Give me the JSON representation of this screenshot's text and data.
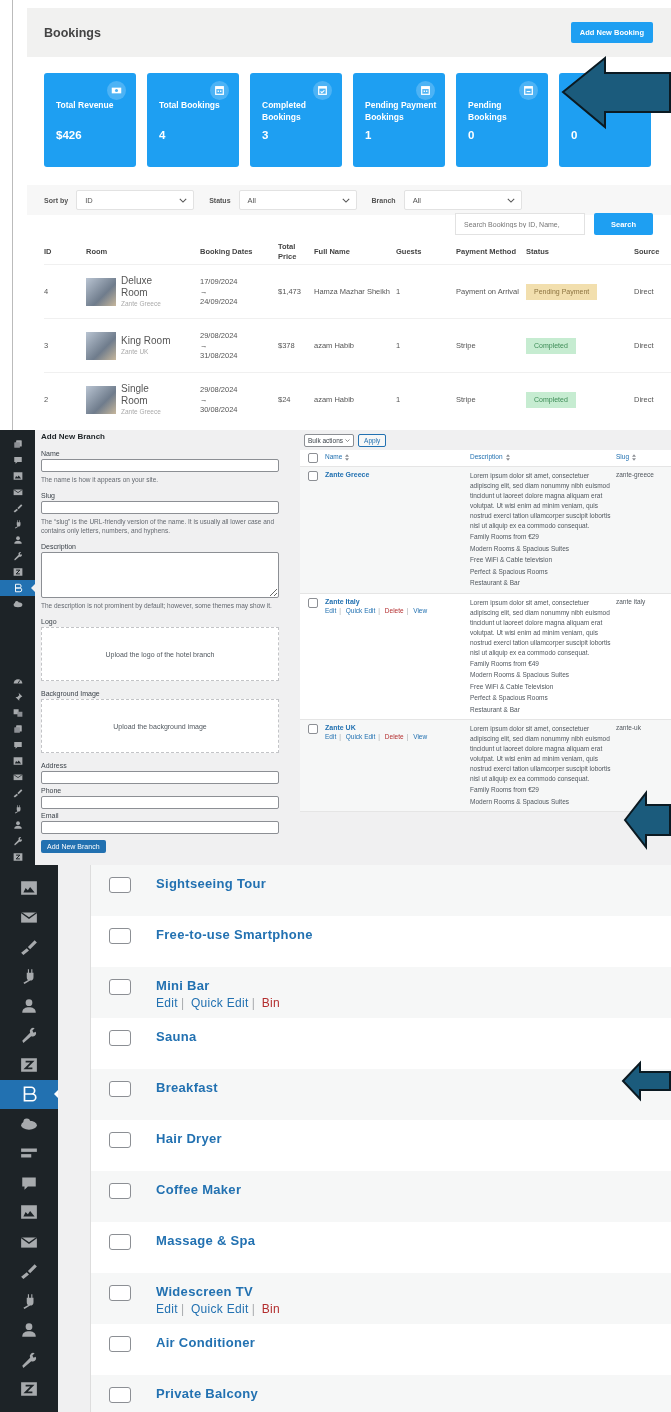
{
  "bookings": {
    "title": "Bookings",
    "add_button": "Add New Booking",
    "cards": [
      {
        "label": "Total Revenue",
        "value": "$426",
        "kind": "money"
      },
      {
        "label": "Total Bookings",
        "value": "4",
        "kind": "calendar"
      },
      {
        "label": "Completed Bookings",
        "value": "3",
        "kind": "calendar-check"
      },
      {
        "label": "Pending Payment Bookings",
        "value": "1",
        "kind": "calendar"
      },
      {
        "label": "Pending Bookings",
        "value": "0",
        "kind": "calendar-minus"
      },
      {
        "value": "0"
      }
    ],
    "filters": [
      {
        "label": "Sort by",
        "value": "ID"
      },
      {
        "label": "Status",
        "value": "All"
      },
      {
        "label": "Branch",
        "value": "All"
      }
    ],
    "search": {
      "placeholder": "Search Bookings by ID, Name,",
      "button": "Search"
    },
    "columns": [
      "ID",
      "Room",
      "Booking Dates",
      "Total Price",
      "Full Name",
      "Guests",
      "Payment Method",
      "Status",
      "Source"
    ],
    "rows": [
      {
        "id": "4",
        "room": "Deluxe Room",
        "branch": "Zante Greece",
        "start": "17/09/2024",
        "arrow": "→",
        "end": "24/09/2024",
        "price": "$1,473",
        "name": "Hamza Mazhar Sheikh",
        "guests": "1",
        "payment": "Payment on Arrival",
        "status": "Pending Payment",
        "kind": "pending",
        "source": "Direct"
      },
      {
        "id": "3",
        "room": "King Room",
        "branch": "Zante UK",
        "start": "29/08/2024",
        "arrow": "→",
        "end": "31/08/2024",
        "price": "$378",
        "name": "azam Habib",
        "guests": "1",
        "payment": "Stripe",
        "status": "Completed",
        "kind": "completed",
        "source": "Direct"
      },
      {
        "id": "2",
        "room": "Single Room",
        "branch": "Zante Greece",
        "start": "29/08/2024",
        "arrow": "→",
        "end": "30/08/2024",
        "price": "$24",
        "name": "azam Habib",
        "guests": "1",
        "payment": "Stripe",
        "status": "Completed",
        "kind": "completed",
        "source": "Direct"
      }
    ]
  },
  "branches": {
    "sidebar": {
      "groups": [
        {
          "items": [
            {
              "kind": "pages",
              "selected": false
            },
            {
              "kind": "comment",
              "selected": false
            },
            {
              "kind": "media",
              "selected": false
            },
            {
              "kind": "mail",
              "selected": false
            },
            {
              "kind": "brush",
              "selected": false
            },
            {
              "kind": "plugin",
              "selected": false
            },
            {
              "kind": "user",
              "selected": false
            },
            {
              "kind": "wrench",
              "selected": false
            },
            {
              "kind": "z",
              "selected": false
            },
            {
              "kind": "b",
              "selected": true
            },
            {
              "kind": "cloud",
              "selected": false
            }
          ]
        },
        {
          "items": [
            {
              "kind": "gauge",
              "selected": false
            },
            {
              "kind": "pin",
              "selected": false
            },
            {
              "kind": "translate",
              "selected": false
            },
            {
              "kind": "pages",
              "selected": false
            },
            {
              "kind": "comment",
              "selected": false
            },
            {
              "kind": "media",
              "selected": false
            },
            {
              "kind": "mail",
              "selected": false
            },
            {
              "kind": "brush",
              "selected": false
            },
            {
              "kind": "plugin",
              "selected": false
            },
            {
              "kind": "user",
              "selected": false
            },
            {
              "kind": "wrench",
              "selected": false
            },
            {
              "kind": "z",
              "selected": false
            }
          ]
        }
      ]
    },
    "form": {
      "title": "Add New Branch",
      "button": "Add New Branch",
      "fields": [
        {
          "label": "Name",
          "kind": "input",
          "hint": "The name is how it appears on your site."
        },
        {
          "label": "Slug",
          "kind": "input",
          "hint": "The “slug” is the URL-friendly version of the name. It is usually all lower case and contains only letters, numbers, and hyphens."
        },
        {
          "label": "Description",
          "kind": "textarea",
          "hint": "The description is not prominent by default; however, some themes may show it."
        },
        {
          "label": "Logo",
          "kind": "upload",
          "prompt": "Upload the logo of the hotel branch"
        },
        {
          "label": "Background Image",
          "kind": "upload",
          "prompt": "Upload the background image"
        },
        {
          "label": "Address",
          "kind": "input"
        },
        {
          "label": "Phone",
          "kind": "input"
        },
        {
          "label": "Email",
          "kind": "input"
        }
      ]
    },
    "table": {
      "bulk": "Bulk actions",
      "apply": "Apply",
      "select_all_checked": false,
      "columns": [
        "Name",
        "Description",
        "Slug"
      ],
      "separator": "|",
      "rows": [
        {
          "name": "Zante Greece",
          "checked": false,
          "description": "Lorem ipsum dolor sit amet, consectetuer adipiscing elit, sed diam nonummy nibh euismod tincidunt ut laoreet dolore magna aliquam erat volutpat. Ut wisi enim ad minim veniam, quis nostrud exerci tation ullamcorper suscipit lobortis nisl ut aliquip ex ea commodo consequat.",
          "features": [
            "Family Rooms from €29",
            "Modern Rooms & Spacious Suites",
            "Free WiFi & Cable television",
            "Perfect & Spacious Rooms",
            "Restaurant & Bar"
          ],
          "slug": "zante-greece"
        },
        {
          "name": "Zante Italy",
          "checked": false,
          "actions": [
            {
              "label": "Edit",
              "danger": false
            },
            {
              "label": "Quick Edit",
              "danger": false
            },
            {
              "label": "Delete",
              "danger": true
            },
            {
              "label": "View",
              "danger": false
            }
          ],
          "description": "Lorem ipsum dolor sit amet, consectetuer adipiscing elit, sed diam nonummy nibh euismod tincidunt ut laoreet dolore magna aliquam erat volutpat. Ut wisi enim ad minim veniam, quis nostrud exerci tation ullamcorper suscipit lobortis nisl ut aliquip ex ea commodo consequat.",
          "features": [
            "Family Rooms from €49",
            "Modern Rooms & Spacious Suites",
            "Free WiFi & Cable Television",
            "Perfect & Spacious Rooms",
            "Restaurant & Bar"
          ],
          "slug": "zante italy"
        },
        {
          "name": "Zante UK",
          "checked": false,
          "actions": [
            {
              "label": "Edit",
              "danger": false
            },
            {
              "label": "Quick Edit",
              "danger": false
            },
            {
              "label": "Delete",
              "danger": true
            },
            {
              "label": "View",
              "danger": false
            }
          ],
          "description": "Lorem ipsum dolor sit amet, consectetuer adipiscing elit, sed diam nonummy nibh euismod tincidunt ut laoreet dolore magna aliquam erat volutpat. Ut wisi enim ad minim veniam, quis nostrud exerci tation ullamcorper suscipit lobortis nisl ut aliquip ex ea commodo consequat.",
          "features": [
            "Family Rooms from €29",
            "Modern Rooms & Spacious Suites"
          ],
          "slug": "zante-uk"
        }
      ]
    }
  },
  "amenities": {
    "sidebar": {
      "items": [
        {
          "kind": "media",
          "selected": false
        },
        {
          "kind": "mail",
          "selected": false
        },
        {
          "kind": "brush",
          "selected": false
        },
        {
          "kind": "plugin",
          "selected": false
        },
        {
          "kind": "user",
          "selected": false
        },
        {
          "kind": "wrench",
          "selected": false
        },
        {
          "kind": "z",
          "selected": false
        },
        {
          "kind": "b",
          "selected": true
        },
        {
          "kind": "cloud",
          "selected": false
        },
        {
          "kind": "list",
          "selected": false
        },
        {
          "kind": "comment",
          "selected": false
        },
        {
          "kind": "media",
          "selected": false
        },
        {
          "kind": "mail",
          "selected": false
        },
        {
          "kind": "brush",
          "selected": false
        },
        {
          "kind": "plugin",
          "selected": false
        },
        {
          "kind": "user",
          "selected": false
        },
        {
          "kind": "wrench",
          "selected": false
        },
        {
          "kind": "z",
          "selected": false
        }
      ]
    },
    "separator": "|",
    "rows": [
      {
        "name": "Sightseeing Tour",
        "checked": false
      },
      {
        "name": "Free-to-use Smartphone",
        "checked": false
      },
      {
        "name": "Mini Bar",
        "checked": false,
        "actions": [
          {
            "label": "Edit",
            "danger": false
          },
          {
            "label": "Quick Edit",
            "danger": false
          },
          {
            "label": "Bin",
            "danger": true
          }
        ]
      },
      {
        "name": "Sauna",
        "checked": false
      },
      {
        "name": "Breakfast",
        "checked": false
      },
      {
        "name": "Hair Dryer",
        "checked": false
      },
      {
        "name": "Coffee Maker",
        "checked": false
      },
      {
        "name": "Massage & Spa",
        "checked": false
      },
      {
        "name": "Widescreen TV",
        "checked": false,
        "actions": [
          {
            "label": "Edit",
            "danger": false
          },
          {
            "label": "Quick Edit",
            "danger": false
          },
          {
            "label": "Bin",
            "danger": true
          }
        ]
      },
      {
        "name": "Air Conditioner",
        "checked": false
      },
      {
        "name": "Private Balcony",
        "checked": false
      }
    ]
  }
}
